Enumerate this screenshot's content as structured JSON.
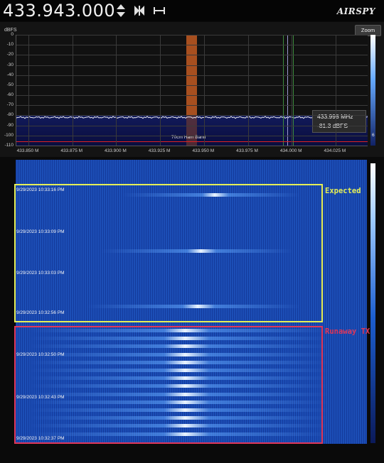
{
  "header": {
    "frequency": "433.943.000",
    "brand": "AIRSPY"
  },
  "spectrum": {
    "y_unit": "dBFS",
    "zoom_label": "Zoom",
    "y_ticks": [
      "0",
      "-10",
      "-20",
      "-30",
      "-40",
      "-50",
      "-60",
      "-70",
      "-80",
      "-90",
      "-100",
      "-110"
    ],
    "x_ticks": [
      "433.850 M",
      "433.875 M",
      "433.900 M",
      "433.925 M",
      "433.950 M",
      "433.975 M",
      "434.000 M",
      "434.025 M"
    ],
    "band_label": "70cm Ham Band",
    "noise_floor_dbfs": -82,
    "tooltip": {
      "freq": "433.998 MHz",
      "level": "-81.3 dBFS"
    },
    "scale_value": "6"
  },
  "waterfall": {
    "timestamps": [
      "9/29/2023 10:33:16 PM",
      "9/29/2023 10:33:09 PM",
      "9/29/2023 10:33:03 PM",
      "9/29/2023 10:32:56 PM",
      "9/29/2023 10:32:50 PM",
      "9/29/2023 10:32:43 PM",
      "9/29/2023 10:32:37 PM"
    ],
    "expected_label": "Expected",
    "runaway_label": "Runaway TX"
  },
  "colors": {
    "expected": "#e5ef57",
    "runaway": "#e0375a",
    "band": "#c25a22",
    "waterfall_bg": "#1a4ab0"
  }
}
